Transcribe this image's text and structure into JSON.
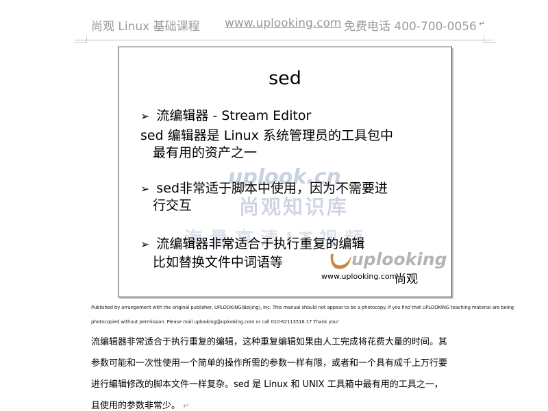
{
  "header": {
    "course": "尚观 Linux 基础课程",
    "site": "www.uplooking.com",
    "phone": "免费电话 400-700-0056",
    "mark": "↵"
  },
  "slide": {
    "title": "sed",
    "bullet1": "流编辑器 - Stream Editor",
    "body1_line1": "sed 编辑器是 Linux 系统管理员的工具包中",
    "body1_line2": "最有用的资产之一",
    "bullet2_line1": "sed非常适于脚本中使用，因为不需要进",
    "bullet2_line2": "行交互",
    "bullet3_line1": "流编辑器非常适合于执行重复的编辑",
    "bullet3_line2": "比如替换文件中词语等",
    "arrow": "➢",
    "watermark": {
      "uplook": "uplook.cn",
      "zhiku": "尚观知识库",
      "haiyang": "海量高清IT视频"
    },
    "logo": {
      "name": "uplooking",
      "url": "www.uplooking.com",
      "cn": "尚观"
    }
  },
  "notice": {
    "line1": "Published by arrangement with the original publisher, UPLOOKING(Beijing), Inc. This manual should not appear to be a photocopy. If you find that UPLOOKING teaching material are being",
    "line2": "photocopied without permission. Please mail uplooking@uplooking.com or call 010-62113516 17 Thank you!"
  },
  "paragraph": {
    "line1": "流编辑器非常适合于执行重复的编辑，这种重复编辑如果由人工完成将花费大量的时间。其",
    "line2": "参数可能和一次性使用一个简单的操作所需的参数一样有限，或者和一个具有成千上万行要",
    "line3": "进行编辑修改的脚本文件一样复杂。sed 是 Linux 和 UNIX 工具箱中最有用的工具之一，",
    "line4": "且使用的参数非常少。",
    "mark": "↵"
  }
}
